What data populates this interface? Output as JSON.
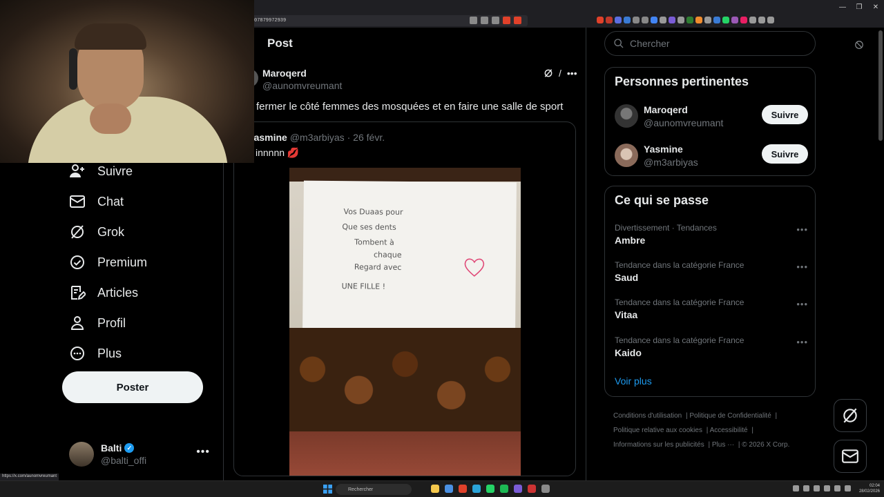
{
  "browser": {
    "url": "07879972939",
    "status_url": "https://x.com/aunomvreumant"
  },
  "nav": {
    "items": [
      {
        "label": "Suivre",
        "icon": "person-add-icon"
      },
      {
        "label": "Chat",
        "icon": "mail-icon"
      },
      {
        "label": "Grok",
        "icon": "grok-icon"
      },
      {
        "label": "Premium",
        "icon": "premium-badge-icon"
      },
      {
        "label": "Articles",
        "icon": "article-edit-icon"
      },
      {
        "label": "Profil",
        "icon": "profile-icon"
      },
      {
        "label": "Plus",
        "icon": "more-circle-icon"
      }
    ],
    "post_button": "Poster",
    "account": {
      "name": "Balti",
      "handle": "@balti_offi",
      "verified": true
    }
  },
  "main": {
    "title": "Post",
    "post": {
      "author_name": "Maroqerd",
      "author_handle": "@aunomvreumant",
      "text": "fermer le côté femmes des mosquées et en faire une salle de sport",
      "quote": {
        "name": "Yasmine",
        "handle": "@m3arbiyas",
        "date": "· 26 févr.",
        "text": "innnnn 💋",
        "image_note": [
          "Vos Duaas pour",
          "Que ses dents",
          "Tombent à",
          "chaque",
          "Regard avec",
          "UNE FILLE !"
        ]
      }
    }
  },
  "sidebar": {
    "search_placeholder": "Chercher",
    "people": {
      "title": "Personnes pertinentes",
      "items": [
        {
          "name": "Maroqerd",
          "handle": "@aunomvreumant",
          "button": "Suivre"
        },
        {
          "name": "Yasmine",
          "handle": "@m3arbiyas",
          "button": "Suivre"
        }
      ]
    },
    "trends": {
      "title": "Ce qui se passe",
      "items": [
        {
          "context": "Divertissement · Tendances",
          "name": "Ambre"
        },
        {
          "context": "Tendance dans la catégorie France",
          "name": "Saud"
        },
        {
          "context": "Tendance dans la catégorie France",
          "name": "Vitaa"
        },
        {
          "context": "Tendance dans la catégorie France",
          "name": "Kaido"
        }
      ],
      "more": "Voir plus"
    },
    "footer": {
      "links": [
        "Conditions d'utilisation",
        "Politique de Confidentialité",
        "Politique relative aux cookies",
        "Accessibilité",
        "Informations sur les publicités",
        "Plus ···"
      ],
      "copyright": "© 2026 X Corp."
    }
  },
  "taskbar": {
    "search_placeholder": "Rechercher",
    "time": "02:04",
    "date": "28/02/2026"
  },
  "colors": {
    "accent": "#1d9bf0",
    "background": "#000000",
    "border": "#2f3336",
    "muted": "#71767b"
  }
}
